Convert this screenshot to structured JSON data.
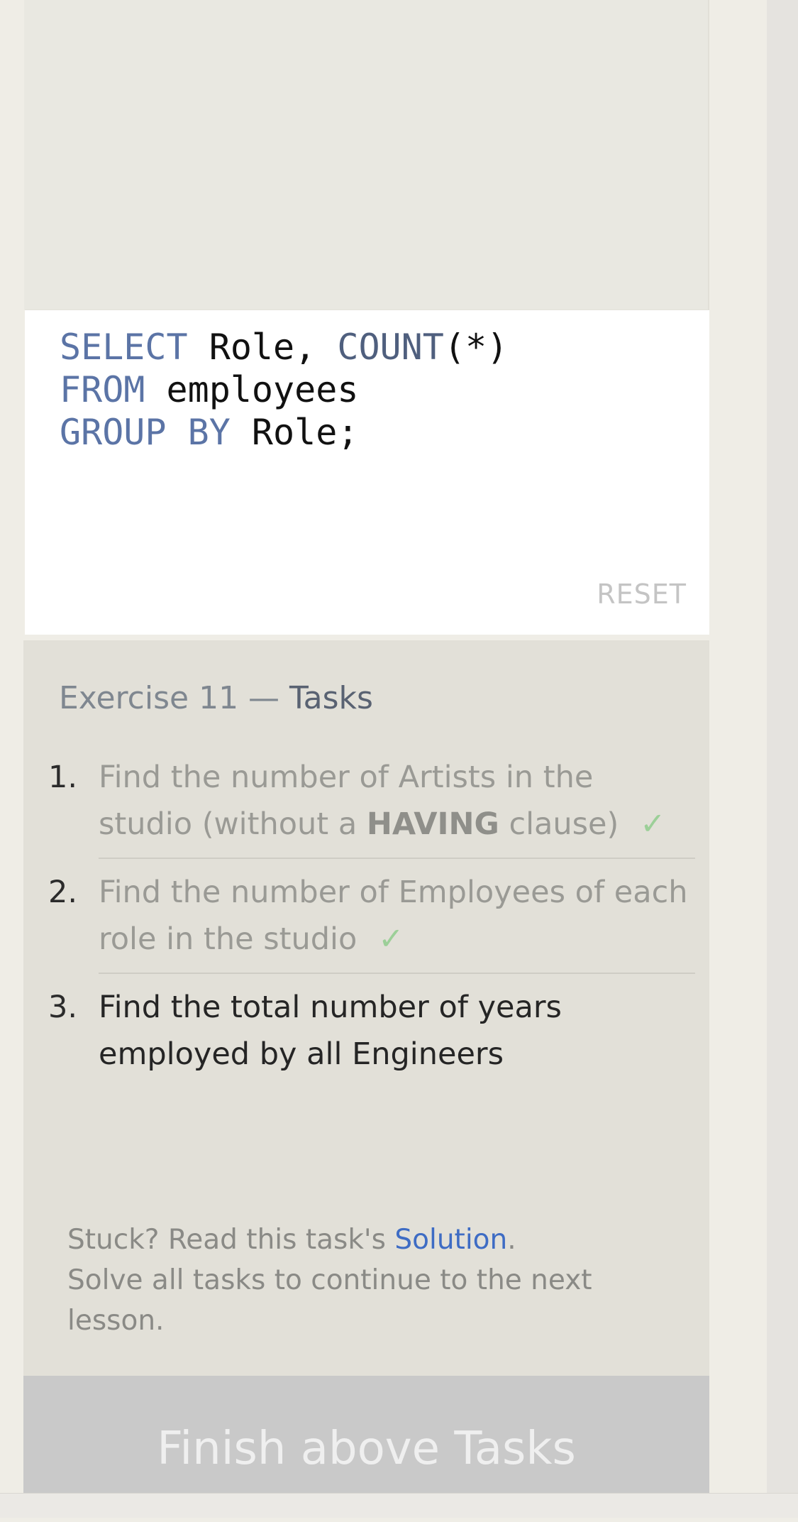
{
  "editor": {
    "code_lines": [
      {
        "kw1": "SELECT",
        "rest1": " Role, ",
        "fn": "COUNT",
        "rest2": "(*)"
      },
      {
        "kw1": "FROM",
        "rest1": " employees"
      },
      {
        "kw1": "GROUP BY",
        "rest1": " Role;"
      }
    ],
    "reset_label": "RESET"
  },
  "tasks": {
    "title_prefix": "Exercise 11 — ",
    "title_strong": "Tasks",
    "items": [
      {
        "number": "1.",
        "text_before": "Find the number of Artists in the studio (without a ",
        "bold": "HAVING",
        "text_after": " clause)",
        "done": true
      },
      {
        "number": "2.",
        "text": "Find the number of Employees of each role in the studio",
        "done": true
      },
      {
        "number": "3.",
        "text": "Find the total number of years employed by all Engineers",
        "done": false
      }
    ],
    "check_glyph": "✓"
  },
  "help": {
    "stuck_prefix": "Stuck? Read this task's ",
    "solution_link": "Solution",
    "stuck_suffix": ".",
    "line2": "Solve all tasks to continue to the next lesson."
  },
  "finish_button": {
    "label": "Finish above Tasks"
  }
}
